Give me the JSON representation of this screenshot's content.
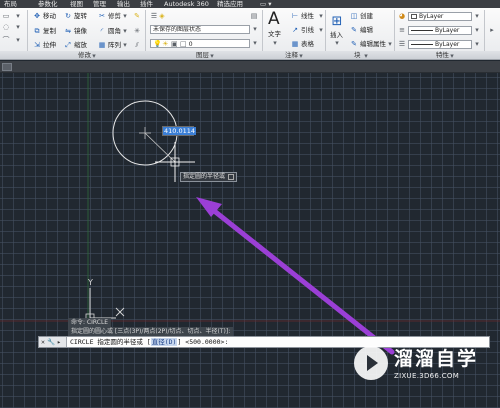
{
  "ribbon_tabs": [
    "布局",
    "参数化",
    "视图",
    "管理",
    "输出",
    "插件",
    "Autodesk 360",
    "精选应用",
    "▭ ▾"
  ],
  "modify_panel": {
    "row1": [
      "移动",
      "旋转",
      "修剪"
    ],
    "row2": [
      "复制",
      "镜像",
      "圆角"
    ],
    "row3": [
      "拉伸",
      "缩放",
      "阵列"
    ],
    "label": "修改"
  },
  "layers_panel": {
    "layer_state": "未保存的图层状态",
    "current_layer": "0",
    "label": "图层"
  },
  "annotation_panel": {
    "text_label": "文字",
    "linear": "线性",
    "leader": "引线",
    "table": "表格",
    "label": "注释"
  },
  "block_panel": {
    "insert_label": "插入",
    "create": "创建",
    "edit": "编辑",
    "edit_attributes": "编辑属性",
    "label": "块"
  },
  "properties_panel": {
    "color": "ByLayer",
    "linetype": "ByLayer",
    "lineweight": "ByLayer",
    "label": "特性"
  },
  "canvas": {
    "radius_value": "410.0114",
    "prompt_tooltip": "指定圆的半径或",
    "ucs_y": "Y",
    "ucs_x": "X"
  },
  "command": {
    "history_1": "命令: CIRCLE",
    "history_2": "指定圆的圆心或 [三点(3P)/两点(2P)/切点、切点、半径(T)]:",
    "buttons": [
      "✕",
      "🔧",
      "▸"
    ],
    "prompt_prefix": "CIRCLE 指定圆的半径或 [",
    "prompt_option": "直径(D)",
    "prompt_suffix": "] <500.0000>:"
  },
  "watermark": {
    "name": "溜溜自学",
    "url": "ZIXUE.3D66.COM"
  },
  "colors": {
    "canvas": "#212830",
    "arrow": "#9b3fd6",
    "circle": "#e6e6e6",
    "highlight": "#3b7fd6"
  }
}
